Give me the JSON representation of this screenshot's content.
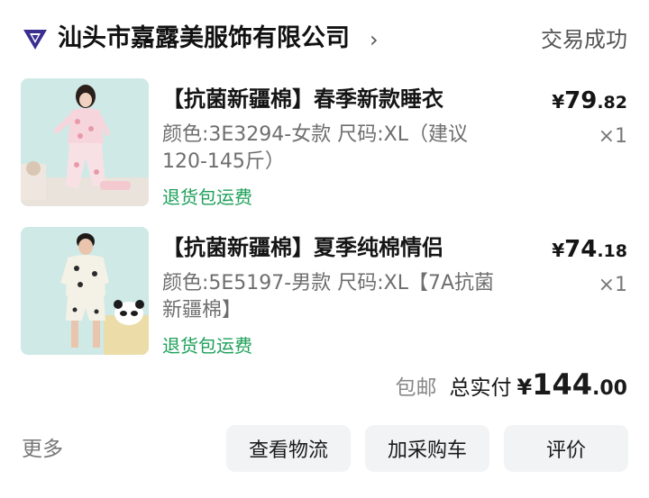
{
  "header": {
    "shop_name": "汕头市嘉露美服饰有限公司",
    "chevron": "›",
    "status": "交易成功",
    "logo_icon": "shop-logo-icon"
  },
  "items": [
    {
      "title": "【抗菌新疆棉】春季新款睡衣",
      "spec": "颜色:3E3294-女款 尺码:XL（建议120-145斤）",
      "tag": "退货包运费",
      "price": {
        "yen": "¥",
        "int": "79",
        "dec": ".82"
      },
      "qty": "×1",
      "image": "woman-pajamas-photo"
    },
    {
      "title": "【抗菌新疆棉】夏季纯棉情侣",
      "spec": "颜色:5E5197-男款 尺码:XL【7A抗菌新疆棉】",
      "tag": "退货包运费",
      "price": {
        "yen": "¥",
        "int": "74",
        "dec": ".18"
      },
      "qty": "×1",
      "image": "man-pajamas-photo"
    }
  ],
  "totals": {
    "free_shipping": "包邮",
    "paid_label": "总实付",
    "yen": "¥",
    "int": "144",
    "dec": ".00"
  },
  "footer": {
    "more": "更多",
    "buttons": [
      "查看物流",
      "加采购车",
      "评价"
    ]
  },
  "colors": {
    "tag_green": "#1ea05a",
    "button_bg": "#f2f3f5",
    "thumb_bg": "#cfe9e6"
  }
}
